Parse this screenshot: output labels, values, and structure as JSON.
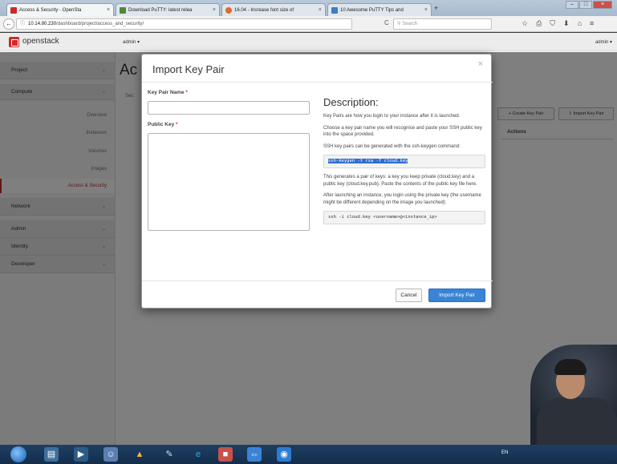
{
  "browser": {
    "tabs": [
      {
        "label": "Access & Security - OpenSta",
        "favicon_color": "#cd2a2a",
        "active": true
      },
      {
        "label": "Download PuTTY: latest relea",
        "favicon_color": "#4c8a2f",
        "active": false
      },
      {
        "label": "16.04 - Increase font size of",
        "favicon_color": "#e06a2a",
        "active": false
      },
      {
        "label": "10 Awesome PuTTY Tips and",
        "favicon_color": "#3b7fc4",
        "active": false
      }
    ],
    "new_tab": "+",
    "back_icon": "←",
    "info_icon": "ⓘ",
    "url_host": "10.14.80.230",
    "url_path": "/dashboard/project/access_and_security/",
    "reload_icon": "C",
    "search_placeholder": "Search",
    "toolbar_icons": [
      "☆",
      "⎙",
      "⛉",
      "⬇",
      "⌂",
      "≡"
    ]
  },
  "openstack": {
    "logo": "openstack",
    "project_selector": "admin ▾",
    "user_menu": "admin ▾",
    "sidebar": {
      "project": "Project",
      "compute": "Compute",
      "items": [
        "Overview",
        "Instances",
        "Volumes",
        "Images",
        "Access & Security"
      ],
      "network": "Network",
      "admin": "Admin",
      "identity": "Identity",
      "developer": "Developer"
    },
    "page_title": "Ac",
    "page_tab": "Sec",
    "create_key_pair": "+ Create Key Pair",
    "import_key_pair_top": "⇪ Import Key Pair",
    "actions_header": "Actions"
  },
  "modal": {
    "title": "Import Key Pair",
    "close": "×",
    "key_pair_name_label": "Key Pair Name",
    "public_key_label": "Public Key",
    "required_mark": "*",
    "key_pair_name_value": "",
    "public_key_value": "",
    "description_heading": "Description:",
    "desc_p1": "Key Pairs are how you login to your instance after it is launched.",
    "desc_p2": "Choose a key pair name you will recognise and paste your SSH public key into the space provided.",
    "desc_p3": "SSH key pairs can be generated with the ssh-keygen command:",
    "code1": "ssh-keygen -t rsa -f cloud.key",
    "desc_p4": "This generates a pair of keys: a key you keep private (cloud.key) and a public key (cloud.key.pub). Paste the contents of the public key file here.",
    "desc_p5": "After launching an instance, you login using the private key (the username might be different depending on the image you launched):",
    "code2": "ssh -i cloud.key <username>@<instance_ip>",
    "cancel": "Cancel",
    "submit": "Import Key Pair"
  },
  "taskbar": {
    "tray_text": "EN"
  }
}
